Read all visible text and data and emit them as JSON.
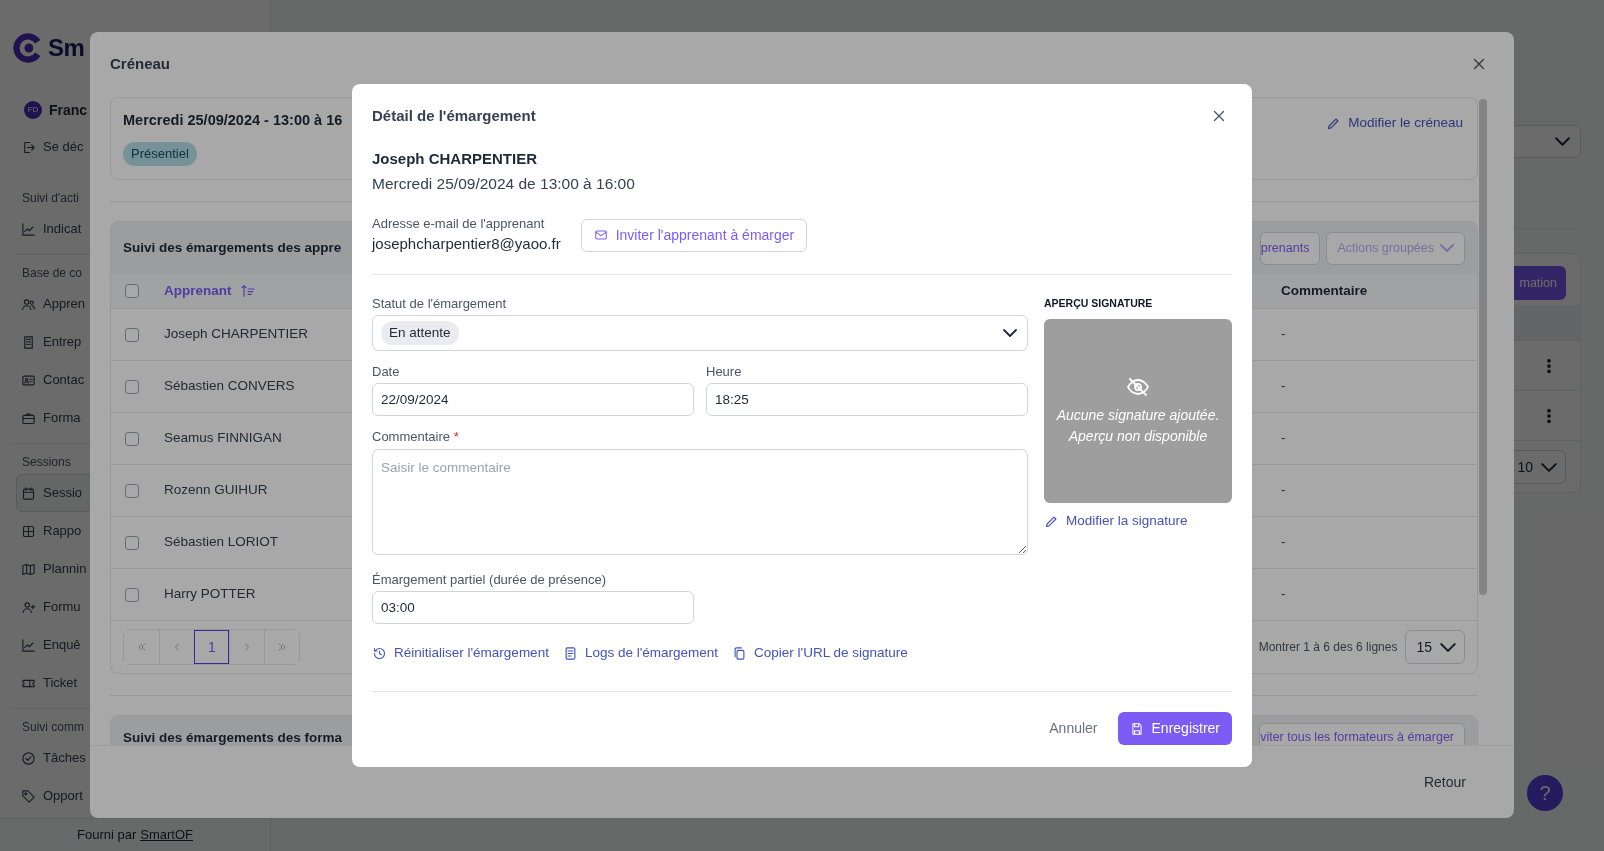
{
  "sidebar": {
    "logo_text": "Sm",
    "user": {
      "initials": "FD",
      "name": "Franc"
    },
    "logout": "Se déc",
    "sections": [
      {
        "title": "Suivi d'acti",
        "items": [
          {
            "label": "Indicat",
            "selected": false
          }
        ]
      },
      {
        "title": "Base de co",
        "items": [
          {
            "label": "Appren",
            "selected": false
          },
          {
            "label": "Entrep",
            "selected": false
          },
          {
            "label": "Contac",
            "selected": false
          },
          {
            "label": "Forma",
            "selected": false
          }
        ]
      },
      {
        "title": "Sessions",
        "items": [
          {
            "label": "Sessio",
            "selected": true
          },
          {
            "label": "Rappo",
            "selected": false
          },
          {
            "label": "Plannin",
            "selected": false
          },
          {
            "label": "Formu",
            "selected": false
          },
          {
            "label": "Enquê",
            "selected": false
          },
          {
            "label": "Ticket",
            "selected": false
          }
        ]
      },
      {
        "title": "Suivi comm",
        "items": [
          {
            "label": "Tâches",
            "selected": false
          },
          {
            "label": "Opport",
            "selected": false
          }
        ]
      }
    ],
    "footer": {
      "prefix": "Fourni par",
      "link": "SmartOF"
    }
  },
  "page": {
    "action_button": "mation",
    "rows": [
      {
        "kind": "actions"
      },
      {
        "kind": "actions"
      }
    ],
    "page_size": "10",
    "help_button": "?"
  },
  "slot_dialog": {
    "title": "Créneau",
    "slot": {
      "title": "Mercredi 25/09/2024 - 13:00 à 16",
      "mode": "Présentiel",
      "edit_link": "Modifier le créneau"
    },
    "learners": {
      "title": "Suivi des émargements des appre",
      "invite_button": "prenants",
      "bulk_button": "Actions groupées",
      "select_all_checked": false,
      "columns": [
        "Apprenant",
        "Commentaire"
      ],
      "rows": [
        {
          "name": "Joseph CHARPENTIER",
          "comment": "-",
          "checked": false
        },
        {
          "name": "Sébastien CONVERS",
          "comment": "-",
          "checked": false
        },
        {
          "name": "Seamus FINNIGAN",
          "comment": "-",
          "checked": false
        },
        {
          "name": "Rozenn GUIHUR",
          "comment": "-",
          "checked": false
        },
        {
          "name": "Sébastien LORIOT",
          "comment": "-",
          "checked": false
        },
        {
          "name": "Harry POTTER",
          "comment": "-",
          "checked": false
        }
      ],
      "pages": [
        {
          "label": "1",
          "selected": true
        }
      ],
      "summary": "Montrer 1 à 6 des 6 lignes",
      "page_size": "15"
    },
    "trainers": {
      "title": "Suivi des émargements des forma",
      "invite_button": "viter tous les formateurs à émarger"
    },
    "back_button": "Retour"
  },
  "detail_dialog": {
    "title": "Détail de l'émargement",
    "learner_name": "Joseph CHARPENTIER",
    "slot_text": "Mercredi 25/09/2024 de 13:00 à 16:00",
    "email_label": "Adresse e-mail de l'apprenant",
    "email": "josephcharpentier8@yaoo.fr",
    "invite_button": "Inviter l'apprenant à émarger",
    "status": {
      "label": "Statut de l'émargement",
      "value": "En attente"
    },
    "date": {
      "label": "Date",
      "value": "22/09/2024"
    },
    "time": {
      "label": "Heure",
      "value": "18:25"
    },
    "comment": {
      "label": "Commentaire",
      "required": true,
      "required_mark": "*",
      "placeholder": "Saisir le commentaire"
    },
    "partial": {
      "label": "Émargement partiel (durée de présence)",
      "value": "03:00"
    },
    "links": [
      {
        "kind": "reset",
        "label": "Réinitialiser l'émargement"
      },
      {
        "kind": "logs",
        "label": "Logs de l'émargement"
      },
      {
        "kind": "copy",
        "label": "Copier l'URL de signature"
      }
    ],
    "signature": {
      "heading": "APERÇU SIGNATURE",
      "message": "Aucune signature ajoutée. Aperçu non disponible",
      "edit_link": "Modifier la signature"
    },
    "cancel_button": "Annuler",
    "save_button": "Enregistrer"
  }
}
